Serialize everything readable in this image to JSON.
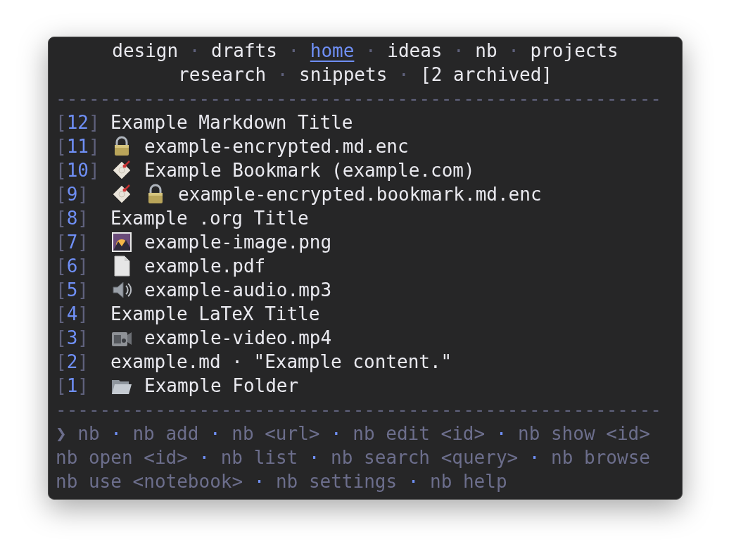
{
  "notebooks": {
    "separator": "·",
    "lines": [
      [
        {
          "label": "design",
          "selected": false
        },
        {
          "label": "drafts",
          "selected": false
        },
        {
          "label": "home",
          "selected": true
        },
        {
          "label": "ideas",
          "selected": false
        },
        {
          "label": "nb",
          "selected": false
        },
        {
          "label": "projects",
          "selected": false
        }
      ],
      [
        {
          "label": "research",
          "selected": false
        },
        {
          "label": "snippets",
          "selected": false
        },
        {
          "label": "[2 archived]",
          "selected": false
        }
      ]
    ]
  },
  "rule_top": "-------------------------------------------------------",
  "items": [
    {
      "id": "[12]",
      "title": "Example Markdown Title"
    },
    {
      "id": "[11]",
      "icons": [
        {
          "kind": "lock"
        }
      ],
      "title": "example-encrypted.md.enc"
    },
    {
      "id": "[10]",
      "icons": [
        {
          "kind": "bookmark"
        }
      ],
      "title": "Example Bookmark (example.com)"
    },
    {
      "id": "[9]",
      "icons": [
        {
          "kind": "bookmark"
        },
        {
          "kind": "lock"
        }
      ],
      "title": "example-encrypted.bookmark.md.enc"
    },
    {
      "id": "[8]",
      "title": "Example .org Title"
    },
    {
      "id": "[7]",
      "icons": [
        {
          "kind": "image"
        }
      ],
      "title": "example-image.png"
    },
    {
      "id": "[6]",
      "icons": [
        {
          "kind": "document"
        }
      ],
      "title": "example.pdf"
    },
    {
      "id": "[5]",
      "icons": [
        {
          "kind": "speaker"
        }
      ],
      "title": "example-audio.mp3"
    },
    {
      "id": "[4]",
      "title": "Example LaTeX Title"
    },
    {
      "id": "[3]",
      "icons": [
        {
          "kind": "video"
        }
      ],
      "title": "example-video.mp4"
    },
    {
      "id": "[2]",
      "title": "example.md · \"Example content.\""
    },
    {
      "id": "[1]",
      "icons": [
        {
          "kind": "folder"
        }
      ],
      "title": "Example Folder"
    }
  ],
  "rule_bottom": "-------------------------------------------------------",
  "help": {
    "prompt": "❯",
    "separator": "·",
    "lines": [
      [
        "nb",
        "nb add",
        "nb <url>",
        "nb edit <id>",
        "nb show <id>"
      ],
      [
        "nb open <id>",
        "nb list",
        "nb search <query>",
        "nb browse"
      ],
      [
        "nb use <notebook>",
        "nb settings",
        "nb help"
      ]
    ]
  }
}
